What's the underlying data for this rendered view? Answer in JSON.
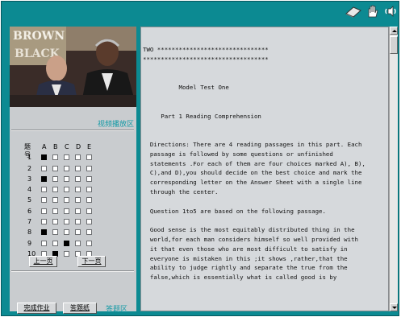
{
  "toolbar": {
    "icons": [
      "eraser-icon",
      "hand-icon",
      "speaker-icon"
    ]
  },
  "video": {
    "banner_text": "BROWN",
    "banner_text_2": "BLACK",
    "label": "视频播放区"
  },
  "answer_sheet": {
    "header": {
      "num": "题号",
      "options": [
        "A",
        "B",
        "C",
        "D",
        "E"
      ]
    },
    "rows": [
      {
        "num": "1",
        "selected": "A"
      },
      {
        "num": "2",
        "selected": ""
      },
      {
        "num": "3",
        "selected": "A"
      },
      {
        "num": "4",
        "selected": ""
      },
      {
        "num": "5",
        "selected": ""
      },
      {
        "num": "6",
        "selected": ""
      },
      {
        "num": "7",
        "selected": ""
      },
      {
        "num": "8",
        "selected": "A"
      },
      {
        "num": "9",
        "selected": "C"
      },
      {
        "num": "10",
        "selected": "B"
      }
    ],
    "prev_label": "上一页",
    "next_label": "下一页"
  },
  "bottom": {
    "finish_label": "完成作业",
    "answer_card_label": "答题纸",
    "area_label": "答题区"
  },
  "reading": {
    "text": "TWO *******************************\n***********************************\n\n\n          Model Test One\n\n\n     Part 1 Reading Comprehension\n\n\n  Directions: There are 4 reading passages in this part. Each\n  passage is followed by some questions or unfinished\n  statements .For each of them are four choices marked A), B),\n  C),and D),you should decide on the best choice and mark the\n  corresponding letter on the Answer Sheet with a single line\n  through the center.\n\n  Question 1to5 are based on the following passage.\n\n  Good sense is the most equitably distributed thing in the\n  world,for each man considers himself so well provided with\n  it that even those who are most difficult to satisfy in\n  everyone is mistaken in this ;it shows ,rather,that the\n  ability to judge rightly and separate the true from the\n  false,which is essentially what is called good is by"
  },
  "colors": {
    "frame": "#0c8a92",
    "accent_label": "#149aa6",
    "panel": "#c9cccf"
  }
}
